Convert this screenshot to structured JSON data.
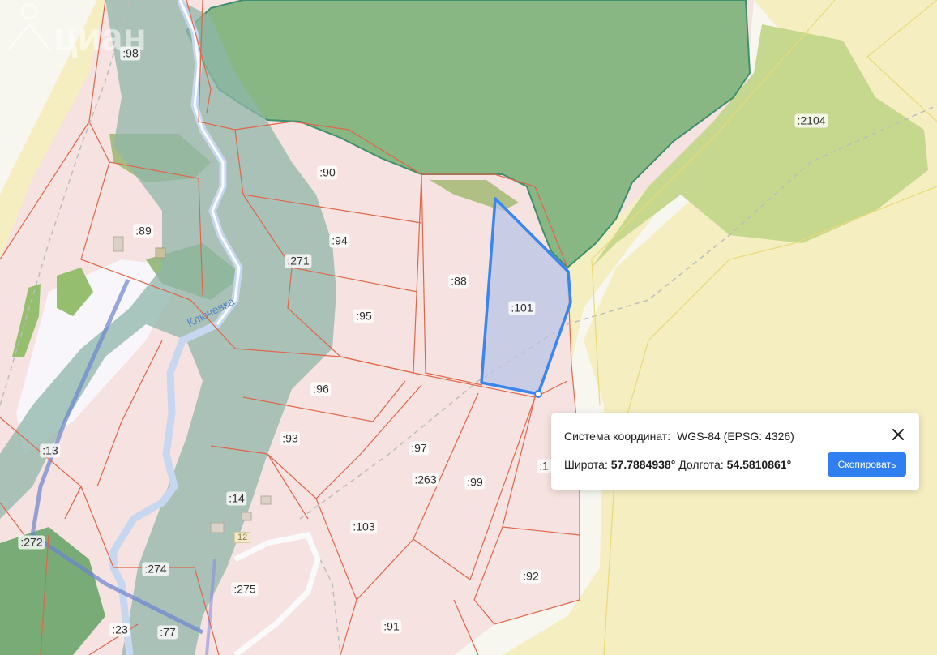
{
  "map": {
    "river_name": "Ключевка",
    "house_number": "12",
    "watermark_text": "циан",
    "plots": [
      {
        "id": "p98",
        "label": ":98"
      },
      {
        "id": "p89",
        "label": ":89"
      },
      {
        "id": "p90",
        "label": ":90"
      },
      {
        "id": "p94",
        "label": ":94"
      },
      {
        "id": "p271",
        "label": ":271"
      },
      {
        "id": "p95",
        "label": ":95"
      },
      {
        "id": "p88",
        "label": ":88"
      },
      {
        "id": "p101",
        "label": ":101"
      },
      {
        "id": "p2104",
        "label": ":2104"
      },
      {
        "id": "p96",
        "label": ":96"
      },
      {
        "id": "p13",
        "label": ":13"
      },
      {
        "id": "p93",
        "label": ":93"
      },
      {
        "id": "p97",
        "label": ":97"
      },
      {
        "id": "p263",
        "label": ":263"
      },
      {
        "id": "p99",
        "label": ":99"
      },
      {
        "id": "p1x",
        "label": ":1"
      },
      {
        "id": "p14",
        "label": ":14"
      },
      {
        "id": "p103",
        "label": ":103"
      },
      {
        "id": "p272",
        "label": ":272"
      },
      {
        "id": "p274",
        "label": ":274"
      },
      {
        "id": "p275",
        "label": ":275"
      },
      {
        "id": "p92",
        "label": ":92"
      },
      {
        "id": "p23",
        "label": ":23"
      },
      {
        "id": "p77",
        "label": ":77"
      },
      {
        "id": "p91",
        "label": ":91"
      }
    ],
    "colors": {
      "background": "#f3f1e4",
      "plot_fill": "#f6e2e0",
      "plot_border": "#e0664a",
      "forest": "#6aa56a",
      "meadow": "#c6d98c",
      "field": "#f6efb8",
      "selection": "#3a86ee"
    }
  },
  "popup": {
    "crs_label": "Система координат:",
    "crs_value": "WGS-84 (EPSG: 4326)",
    "lat_label": "Широта:",
    "lat_value": "57.7884938°",
    "lon_label": "Долгота:",
    "lon_value": "54.5810861°",
    "copy_button": "Скопировать",
    "close_icon": "close-icon"
  }
}
